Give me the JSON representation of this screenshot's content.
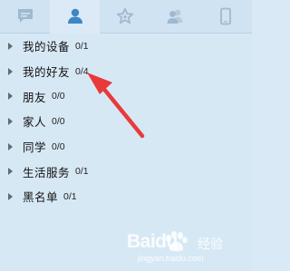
{
  "tabs": [
    {
      "icon": "chat-icon",
      "active": false
    },
    {
      "icon": "contact-person-icon",
      "active": true
    },
    {
      "icon": "star-icon",
      "active": false
    },
    {
      "icon": "group-contacts-icon",
      "active": false
    },
    {
      "icon": "mobile-phone-icon",
      "active": false
    }
  ],
  "groups": [
    {
      "label": "我的设备",
      "count": "0/1"
    },
    {
      "label": "我的好友",
      "count": "0/4"
    },
    {
      "label": "朋友",
      "count": "0/0"
    },
    {
      "label": "家人",
      "count": "0/0"
    },
    {
      "label": "同学",
      "count": "0/0"
    },
    {
      "label": "生活服务",
      "count": "0/1"
    },
    {
      "label": "黑名单",
      "count": "0/1"
    }
  ],
  "annotation": {
    "color": "#e83a3a"
  },
  "watermark": {
    "brand": "Baidu",
    "cn": "经验",
    "url": "jingyan.baidu.com"
  },
  "colors": {
    "icon_inactive": "#9fb9cf",
    "icon_active": "#3d86c6",
    "background": "#d7e8f5"
  }
}
